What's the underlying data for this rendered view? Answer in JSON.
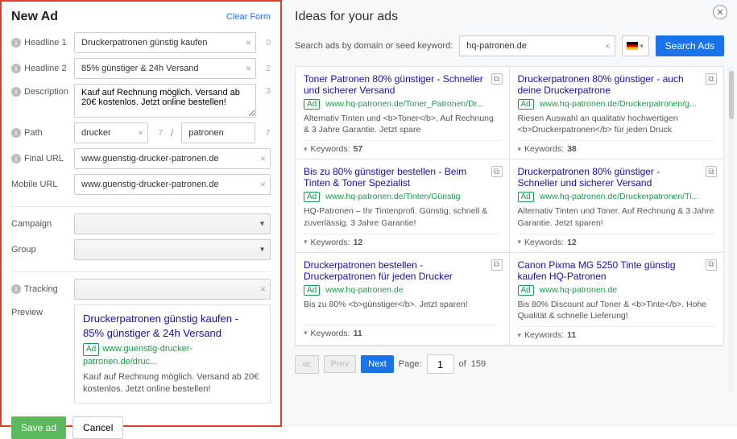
{
  "left": {
    "title": "New Ad",
    "clear_label": "Clear Form",
    "labels": {
      "headline1": "Headline 1",
      "headline2": "Headline 2",
      "description": "Description",
      "path": "Path",
      "final_url": "Final URL",
      "mobile_url": "Mobile URL",
      "campaign": "Campaign",
      "group": "Group",
      "tracking": "Tracking",
      "preview": "Preview"
    },
    "values": {
      "headline1": "Druckerpatronen günstig kaufen",
      "headline2": "85% günstiger & 24h Versand",
      "description": "Kauf auf Rechnung möglich. Versand ab 20€ kostenlos. Jetzt online bestellen!",
      "path1": "drucker",
      "path2": "patronen",
      "final_url": "www.guenstig-drucker-patronen.de",
      "mobile_url": "www.guenstig-drucker-patronen.de"
    },
    "counters": {
      "headline1": "0",
      "headline2": "2",
      "description": "3",
      "path1": "7",
      "path2": "7"
    },
    "preview": {
      "title": "Druckerpatronen günstig kaufen - 85% günstiger & 24h Versand",
      "url": "www.guenstig-drucker-patronen.de/druc...",
      "desc": "Kauf auf Rechnung möglich. Versand ab 20€ kostenlos. Jetzt online bestellen!",
      "ad_label": "Ad"
    },
    "save_label": "Save ad",
    "cancel_label": "Cancel"
  },
  "right": {
    "title": "Ideas for your ads",
    "search_label": "Search ads by domain or seed keyword:",
    "search_value": "hq-patronen.de",
    "search_btn": "Search Ads",
    "keywords_label": "Keywords:",
    "ad_label": "Ad",
    "ads": [
      {
        "title": "Toner Patronen 80% günstiger - Schneller und sicherer Versand",
        "url": "www.hq-patronen.de/Toner_Patronen/Dr...",
        "desc": "Alternativ Tinten und <b>Toner</b>. Auf Rechnung & 3 Jahre Garantie. Jetzt spare",
        "kw": "57"
      },
      {
        "title": "Druckerpatronen 80% günstiger - auch deine Druckerpatrone",
        "url": "www.hq-patronen.de/Druckerpatronen/g...",
        "desc": "Riesen Auswahl an qualitativ hochwertigen <b>Druckerpatronen</b> für jeden Druck",
        "kw": "38"
      },
      {
        "title": "Bis zu 80% günstiger bestellen - Beim Tinten & Toner Spezialist",
        "url": "www.hq-patronen.de/Tinten/Günstig",
        "desc": "HQ-Patronen – Ihr Tintenprofi. Günstig, schnell & zuverlässig. 3 Jahre Garantie!",
        "kw": "12"
      },
      {
        "title": "Druckerpatronen 80% günstiger - Schneller und sicherer Versand",
        "url": "www.hq-patronen.de/Druckerpatronen/Ti...",
        "desc": "Alternativ Tinten und Toner. Auf Rechnung & 3 Jahre Garantie. Jetzt sparen!",
        "kw": "12"
      },
      {
        "title": "Druckerpatronen bestellen - Druckerpatronen für jeden Drucker",
        "url": "www.hq-patronen.de",
        "desc": "Bis zu 80% <b>günstiger</b>. Jetzt sparen!",
        "kw": "11"
      },
      {
        "title": "Canon Pixma MG 5250 Tinte günstig kaufen HQ-Patronen",
        "url": "www.hq-patronen.de",
        "desc": "Bis 80% Discount auf Toner & <b>Tinte</b>. Hohe Qualität & schnelle Lieferung!",
        "kw": "11"
      }
    ],
    "pagination": {
      "prev": "Prev",
      "next": "Next",
      "page_label": "Page:",
      "page": "1",
      "of_label": "of",
      "total": "159",
      "first": "≪"
    }
  }
}
